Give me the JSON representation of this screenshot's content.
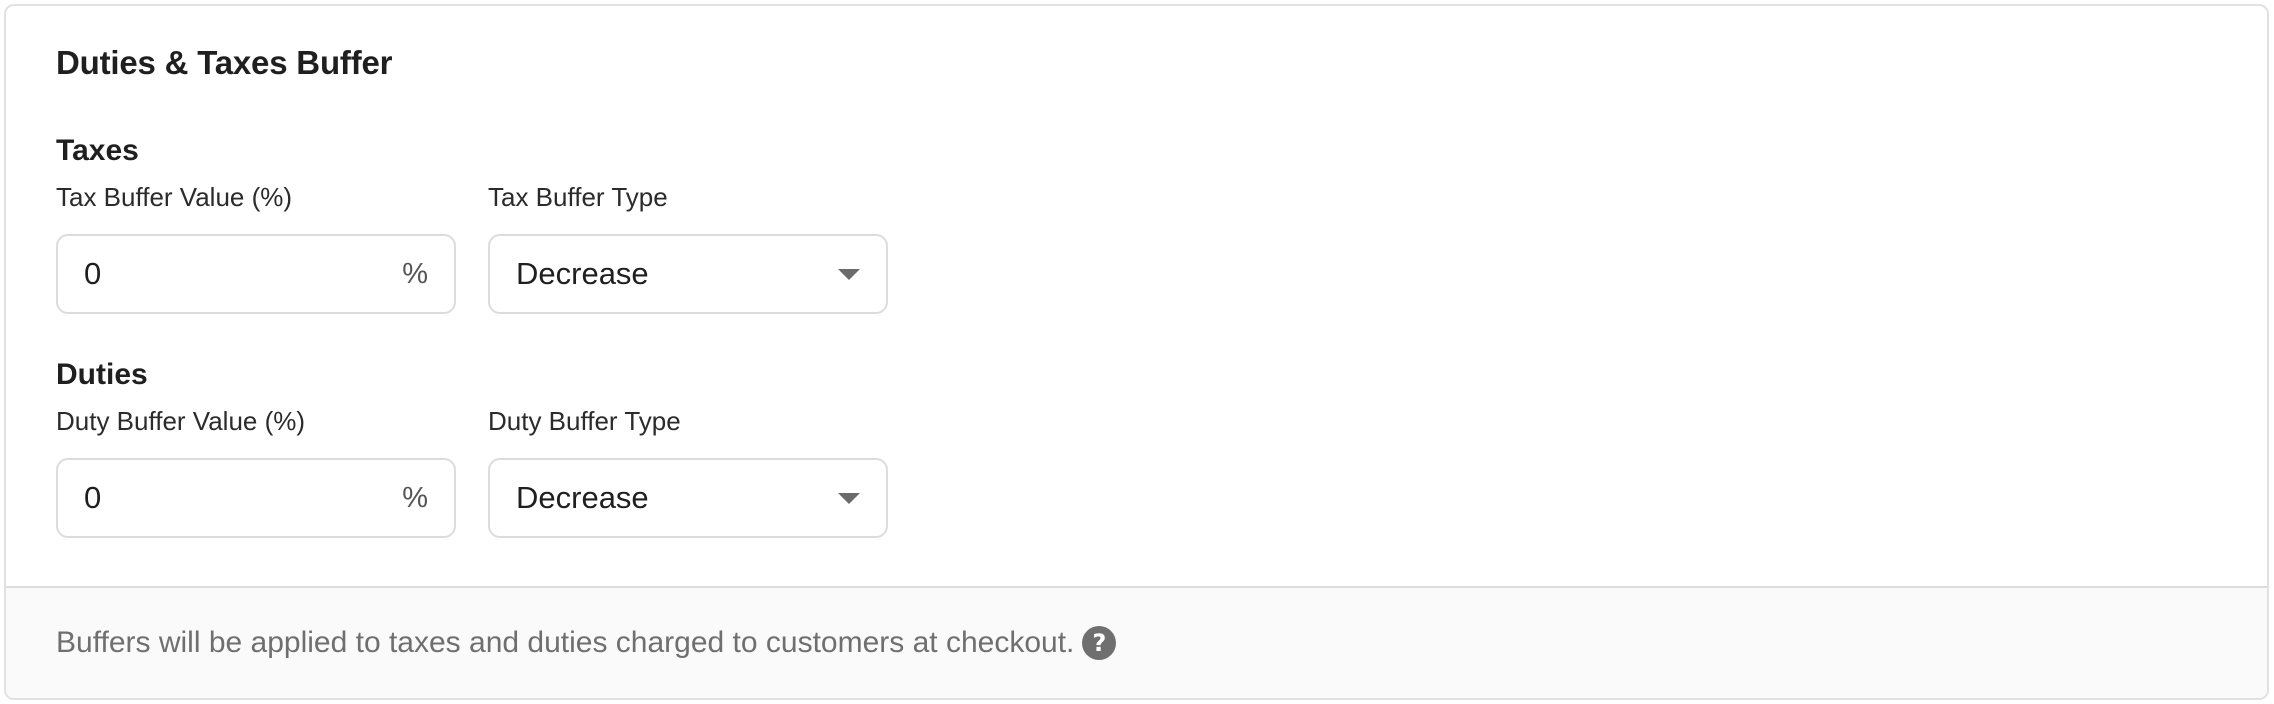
{
  "card": {
    "title": "Duties & Taxes Buffer"
  },
  "taxes": {
    "section_title": "Taxes",
    "value_label": "Tax Buffer Value (%)",
    "value": "0",
    "value_suffix": "%",
    "type_label": "Tax Buffer Type",
    "type_selected": "Decrease"
  },
  "duties": {
    "section_title": "Duties",
    "value_label": "Duty Buffer Value (%)",
    "value": "0",
    "value_suffix": "%",
    "type_label": "Duty Buffer Type",
    "type_selected": "Decrease"
  },
  "footer": {
    "note": "Buffers will be applied to taxes and duties charged to customers at checkout.",
    "help_icon": "question-circle-icon",
    "help_glyph": "?"
  }
}
